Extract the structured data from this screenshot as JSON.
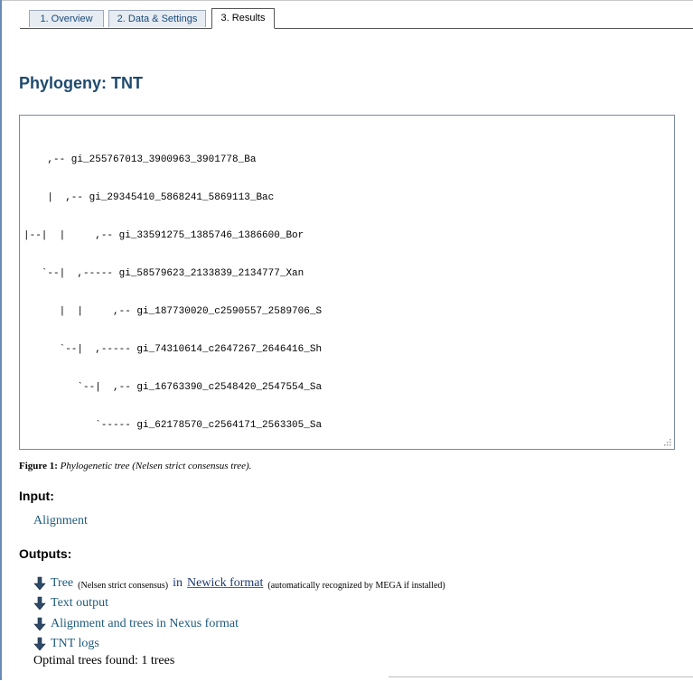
{
  "tabs": [
    {
      "label": "1. Overview"
    },
    {
      "label": "2. Data & Settings"
    },
    {
      "label": "3. Results"
    }
  ],
  "page_title": "Phylogeny: TNT",
  "tree_text": [
    "    ,-- gi_255767013_3900963_3901778_Ba",
    "    |  ,-- gi_29345410_5868241_5869113_Bac",
    "|--|  |     ,-- gi_33591275_1385746_1386600_Bor",
    "   `--|  ,----- gi_58579623_2133839_2134777_Xan",
    "      |  |     ,-- gi_187730020_c2590557_2589706_S",
    "      `--|  ,----- gi_74310614_c2647267_2646416_Sh",
    "         `--|  ,-- gi_16763390_c2548420_2547554_Sa",
    "            `----- gi_62178570_c2564171_2563305_Sa"
  ],
  "figure": {
    "label": "Figure 1:",
    "text": "Phylogenetic tree (Nelsen strict consensus tree)."
  },
  "input_section": {
    "heading": "Input:",
    "link": "Alignment"
  },
  "outputs_section": {
    "heading": "Outputs:",
    "items": [
      {
        "label": "Tree",
        "note": "(Nelsen strict consensus)",
        "in_word": "in",
        "format": "Newick format",
        "suffix": "(automatically recognized by MEGA if installed)"
      },
      {
        "label": "Text output"
      },
      {
        "label": "Alignment and trees in Nexus format"
      },
      {
        "label": "TNT logs"
      }
    ],
    "optimal_text": "Optimal trees found: 1 trees"
  },
  "icons": {
    "download": "download-arrow-icon",
    "resize": "resize-grip-icon"
  }
}
